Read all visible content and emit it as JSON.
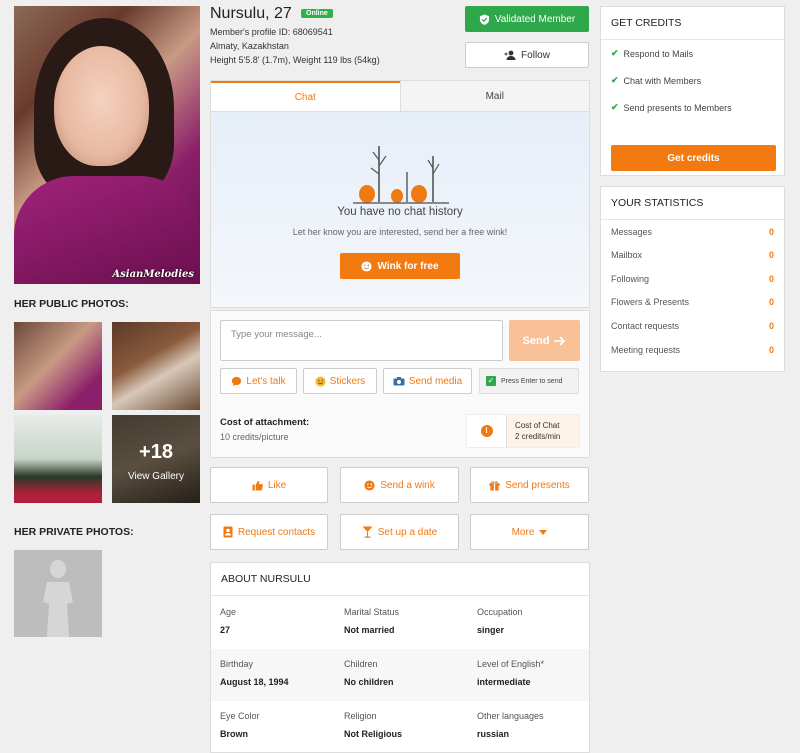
{
  "profile": {
    "name_age": "Nursulu, 27",
    "online_badge": "Online",
    "profile_id": "Member's profile ID: 68069541",
    "location": "Almaty, Kazakhstan",
    "height_weight": "Height 5'5.8' (1.7m), Weight 119 lbs (54kg)",
    "watermark": "AsianMelodies"
  },
  "header_buttons": {
    "validated": "Validated Member",
    "follow": "Follow"
  },
  "photos": {
    "public_label": "HER PUBLIC PHOTOS:",
    "private_label": "HER PRIVATE PHOTOS:",
    "more_count": "+18",
    "view_gallery": "View Gallery"
  },
  "tabs": {
    "chat": "Chat",
    "mail": "Mail"
  },
  "chat": {
    "empty_title": "You have no chat history",
    "empty_sub": "Let her know you are interested, send her a free wink!",
    "wink_free": "Wink for free",
    "placeholder": "Type your message...",
    "send": "Send",
    "lets_talk": "Let's talk",
    "stickers": "Stickers",
    "send_media": "Send media",
    "press_enter": "Press Enter to send",
    "cost_attachment_label": "Cost of attachment:",
    "cost_attachment_value": "10 credits/picture",
    "cost_chat_label": "Cost of Chat",
    "cost_chat_value": "2 credits/min"
  },
  "actions": {
    "like": "Like",
    "send_wink": "Send a wink",
    "send_presents": "Send presents",
    "request_contacts": "Request contacts",
    "setup_date": "Set up a date",
    "more": "More"
  },
  "about": {
    "title": "ABOUT NURSULU",
    "rows": [
      [
        {
          "label": "Age",
          "value": "27"
        },
        {
          "label": "Marital Status",
          "value": "Not married"
        },
        {
          "label": "Occupation",
          "value": "singer"
        }
      ],
      [
        {
          "label": "Birthday",
          "value": "August 18, 1994"
        },
        {
          "label": "Children",
          "value": "No children"
        },
        {
          "label": "Level of English*",
          "value": "intermediate"
        }
      ],
      [
        {
          "label": "Eye Color",
          "value": "Brown"
        },
        {
          "label": "Religion",
          "value": "Not Religious"
        },
        {
          "label": "Other languages",
          "value": "russian"
        }
      ]
    ]
  },
  "credits": {
    "title": "GET CREDITS",
    "features": [
      "Respond to Mails",
      "Chat with Members",
      "Send presents to Members"
    ],
    "button": "Get credits"
  },
  "statistics": {
    "title": "YOUR STATISTICS",
    "items": [
      {
        "label": "Messages",
        "value": "0"
      },
      {
        "label": "Mailbox",
        "value": "0"
      },
      {
        "label": "Following",
        "value": "0"
      },
      {
        "label": "Flowers & Presents",
        "value": "0"
      },
      {
        "label": "Contact requests",
        "value": "0"
      },
      {
        "label": "Meeting requests",
        "value": "0"
      }
    ]
  },
  "colors": {
    "accent": "#f07a12",
    "validated": "#2ea84a",
    "online": "#2fb24c"
  }
}
